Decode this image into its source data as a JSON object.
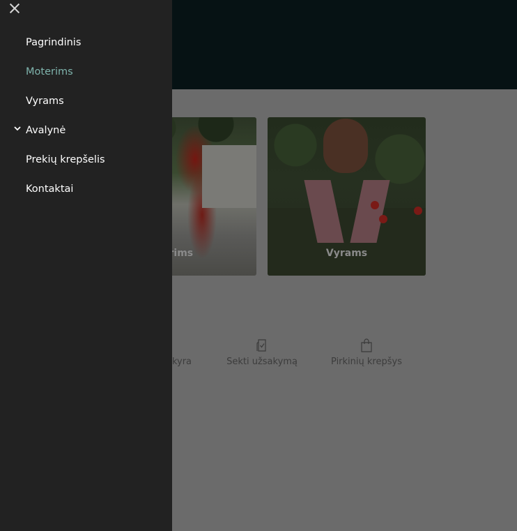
{
  "drawer": {
    "items": [
      {
        "label": "Pagrindinis",
        "active": false
      },
      {
        "label": "Moterims",
        "active": true
      },
      {
        "label": "Vyrams",
        "active": false
      },
      {
        "label": "Avalynė",
        "active": false,
        "expandable": true
      },
      {
        "label": "Prekių krepšelis",
        "active": false
      },
      {
        "label": "Kontaktai",
        "active": false
      }
    ],
    "close_icon": "close-icon",
    "active_color": "#7fb4ad"
  },
  "main": {
    "cards": [
      {
        "label": "erims"
      },
      {
        "label": "Vyrams"
      }
    ],
    "features": [
      {
        "label": "kyra",
        "icon": "truck-icon"
      },
      {
        "label": "Sekti užsakymą",
        "icon": "clipboard-check-icon"
      },
      {
        "label": "Pirkinių krepšys",
        "icon": "shopping-bag-icon"
      }
    ]
  }
}
